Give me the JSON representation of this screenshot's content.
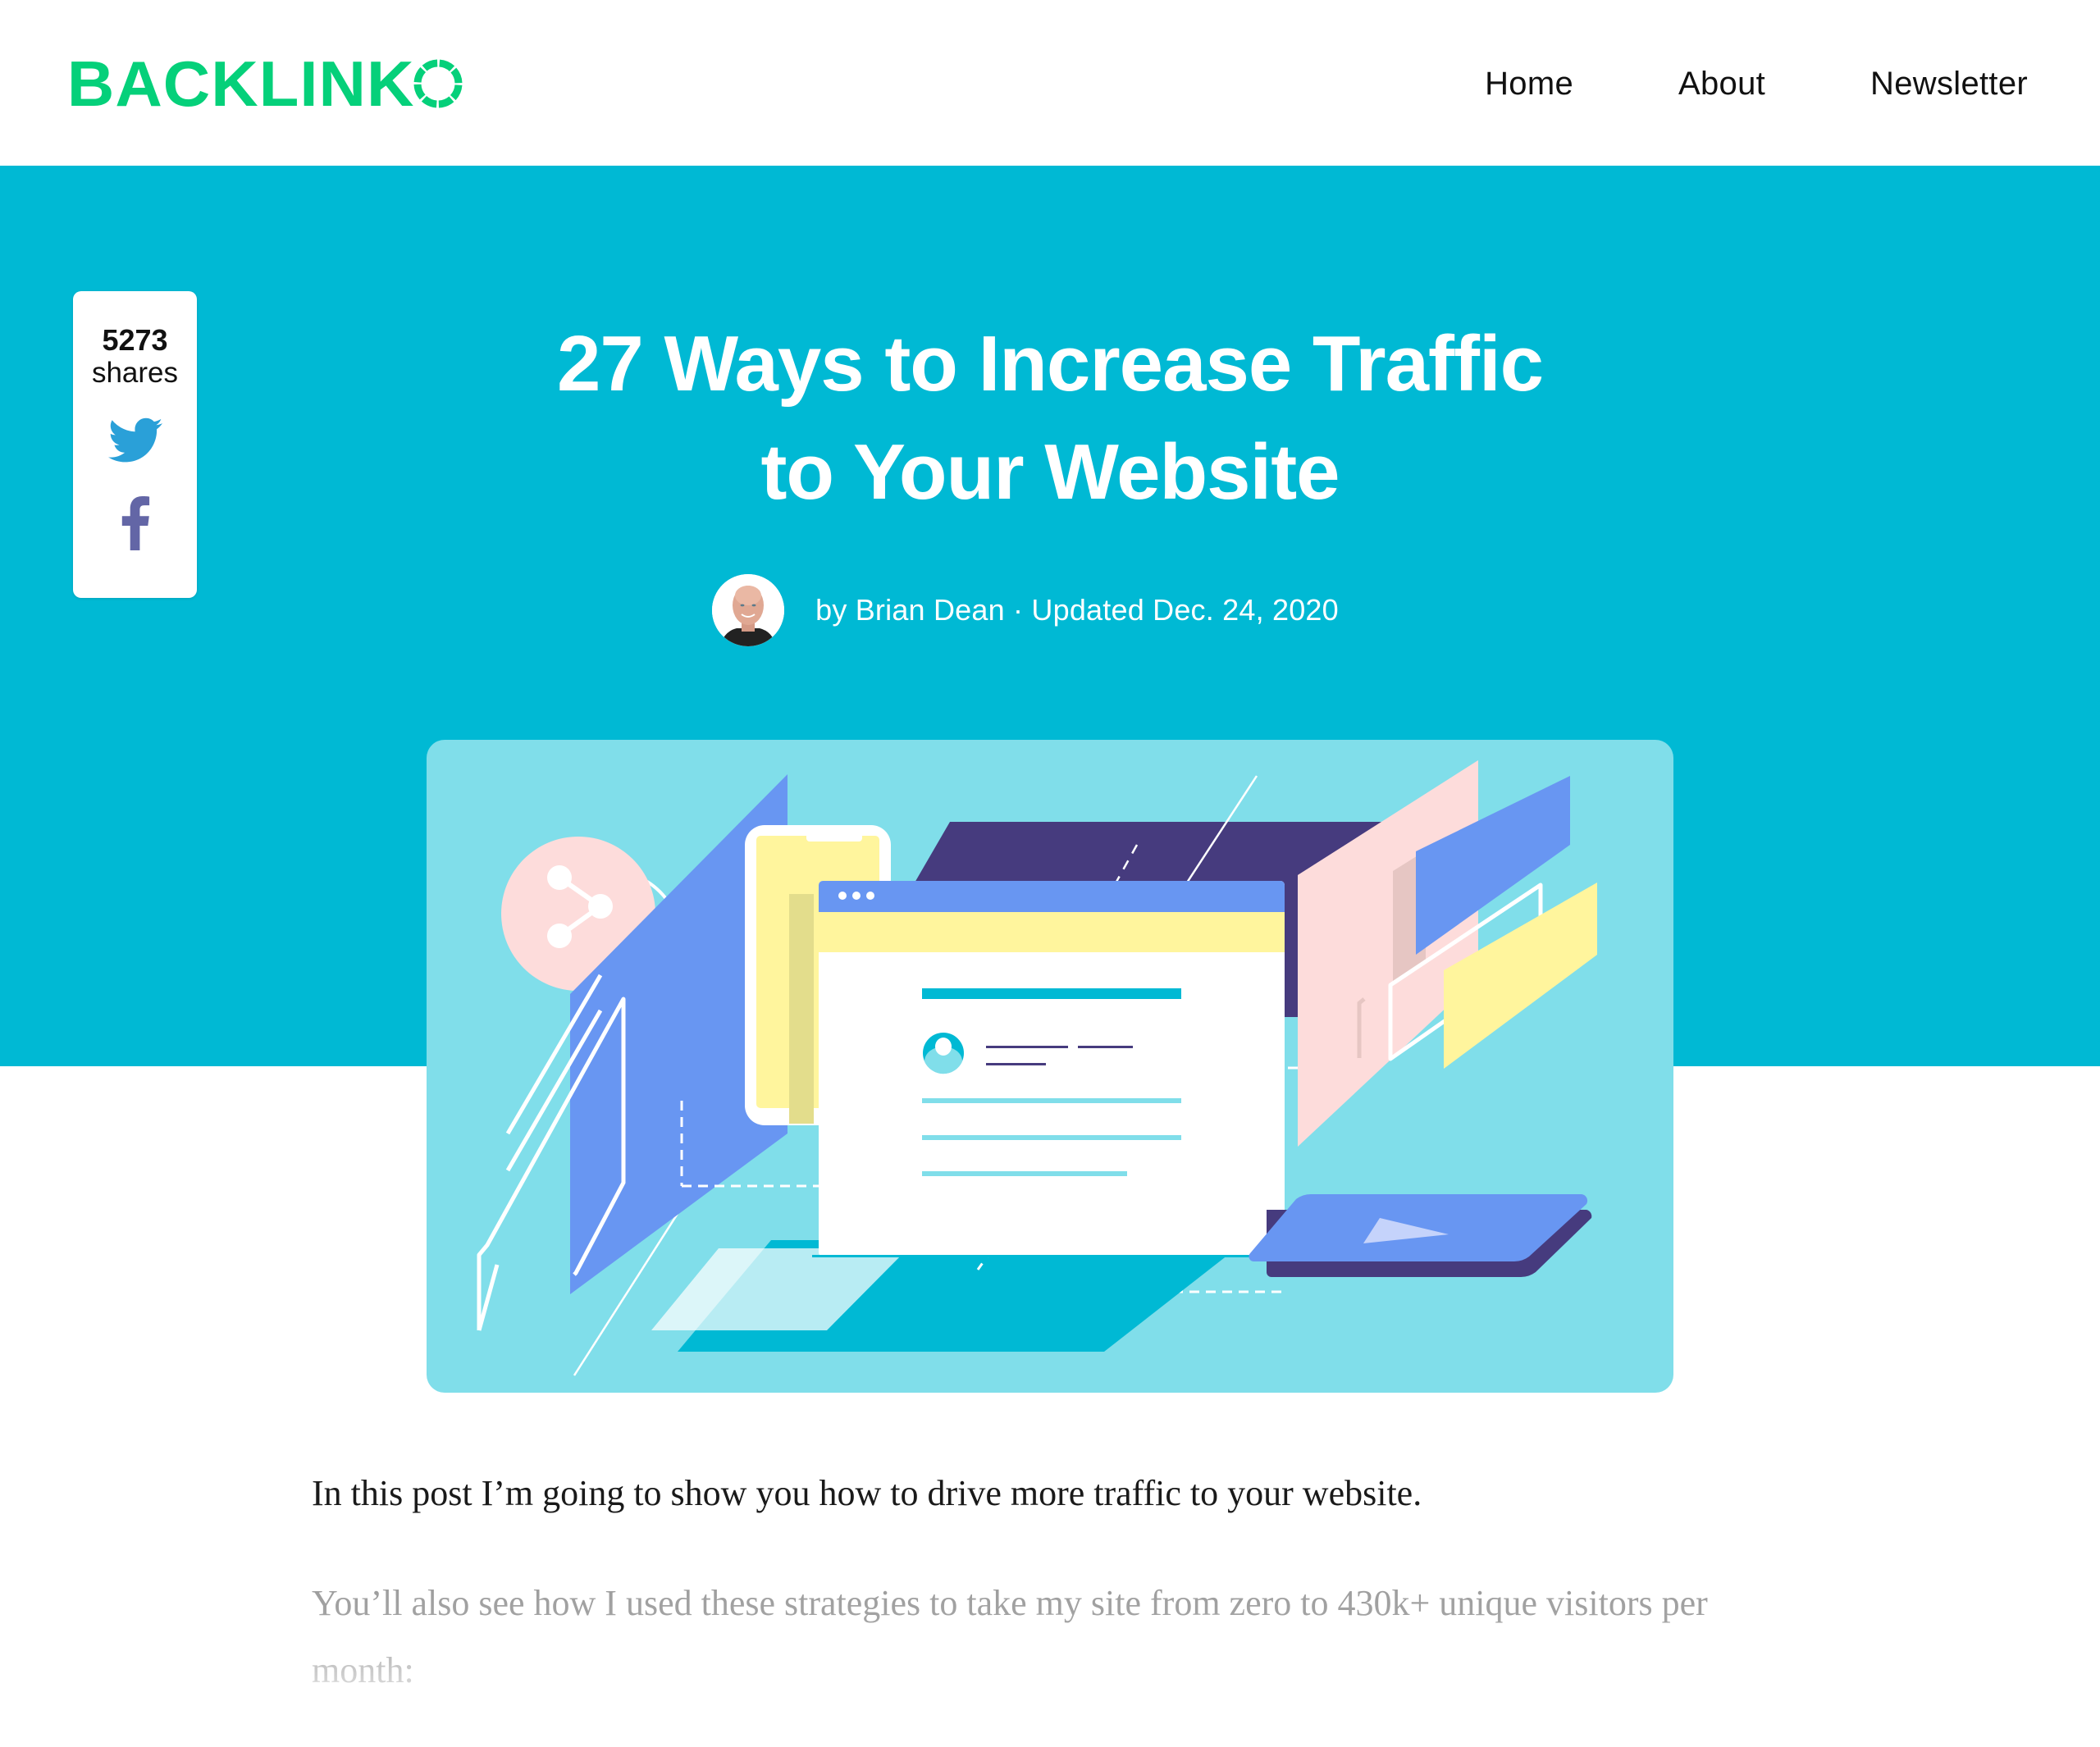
{
  "header": {
    "logo_text": "BACKLINK",
    "logo_icon": "backlinko-o-ring-icon",
    "nav": [
      {
        "label": "Home"
      },
      {
        "label": "About"
      },
      {
        "label": "Newsletter"
      }
    ]
  },
  "colors": {
    "brand_green": "#05d07a",
    "hero_teal": "#00b9d4",
    "card_light_teal": "#80deea",
    "twitter_blue": "#1da1f2",
    "facebook_purple": "#6366a6",
    "illus_blue": "#6896f2",
    "illus_navy": "#463b7e",
    "illus_yellow": "#fff59d",
    "illus_pink": "#fddcdb"
  },
  "share": {
    "count": "5273",
    "label": "shares",
    "icons": [
      "twitter-icon",
      "facebook-icon"
    ]
  },
  "post": {
    "title_line1": "27 Ways to Increase Traffic",
    "title_line2": "to Your Website",
    "byline": "by Brian Dean · Updated Dec. 24, 2020",
    "author_avatar": "author-avatar"
  },
  "illustration": {
    "icons": [
      "share-icon",
      "browser-window",
      "smartphone",
      "chat-bubble",
      "play-button",
      "user-profile-icon"
    ]
  },
  "content": {
    "paragraphs": [
      "In this post I’m going to show you how to drive more traffic to your website.",
      "You’ll also see how I used these strategies to take my site from zero to 430k+ unique visitors per month:"
    ]
  }
}
